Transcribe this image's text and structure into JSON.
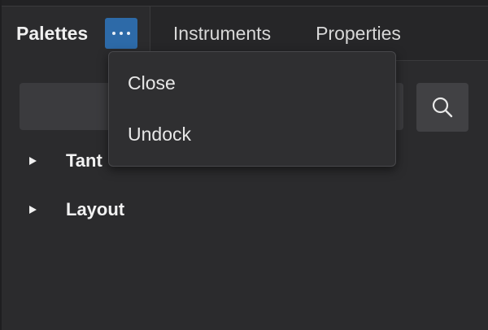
{
  "tabs": [
    {
      "label": "Palettes"
    },
    {
      "label": "Instruments"
    },
    {
      "label": "Properties"
    }
  ],
  "menu_button_icon": "more-horizontal-icon",
  "search": {
    "value": "",
    "placeholder": "",
    "button_icon": "search-icon"
  },
  "tree": {
    "items": [
      {
        "label": "Tant",
        "expanded": false
      },
      {
        "label": "Layout",
        "expanded": false
      }
    ]
  },
  "dropdown": {
    "items": [
      {
        "label": "Close"
      },
      {
        "label": "Undock"
      }
    ]
  },
  "colors": {
    "background": "#2b2b2d",
    "accent": "#2d6aa8",
    "text": "#e6e6e6"
  }
}
